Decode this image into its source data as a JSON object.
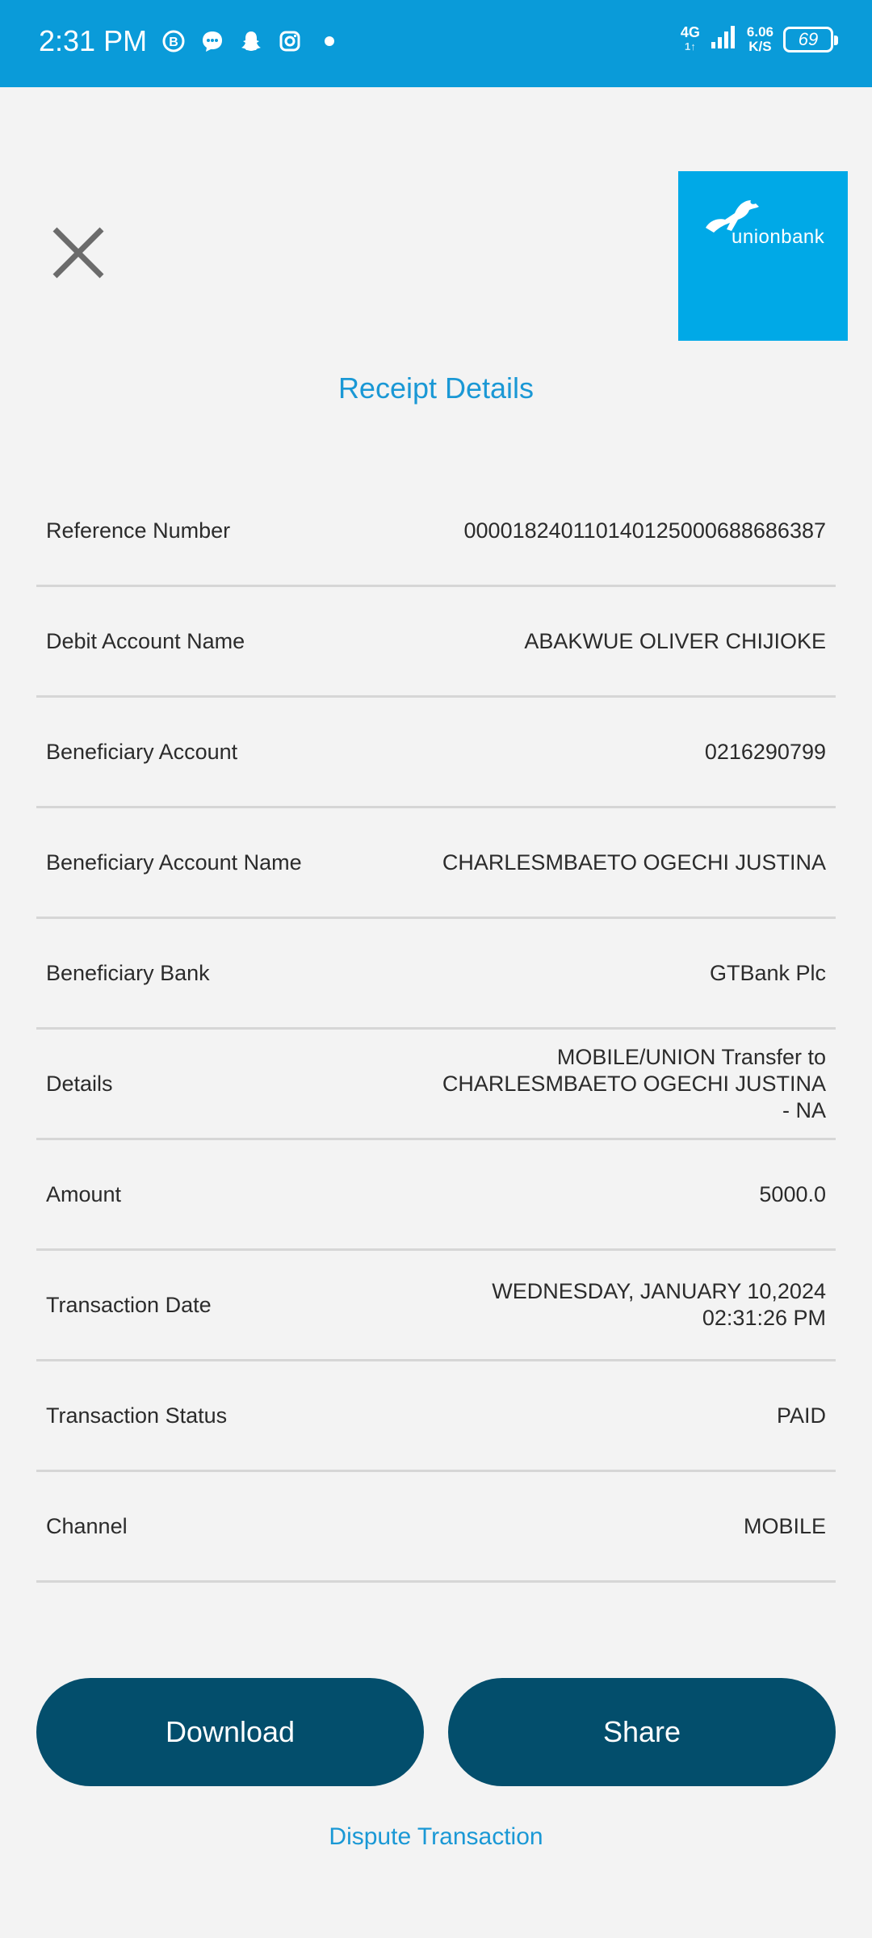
{
  "status_bar": {
    "time": "2:31 PM",
    "network": "4G",
    "network_sub": "1↑",
    "speed_value": "6.06",
    "speed_unit": "K/S",
    "battery": "69",
    "icons": [
      "b-chat-icon",
      "message-icon",
      "snapchat-icon",
      "instagram-icon",
      "dot-icon"
    ]
  },
  "header": {
    "logo_text": "unionbank",
    "title": "Receipt Details"
  },
  "rows": [
    {
      "label": "Reference Number",
      "value": "000018240110140125000688686387"
    },
    {
      "label": "Debit Account Name",
      "value": "ABAKWUE OLIVER CHIJIOKE"
    },
    {
      "label": "Beneficiary Account",
      "value": "0216290799"
    },
    {
      "label": "Beneficiary Account Name",
      "value": "CHARLESMBAETO OGECHI JUSTINA"
    },
    {
      "label": "Beneficiary Bank",
      "value": "GTBank Plc"
    },
    {
      "label": "Details",
      "value": "MOBILE/UNION Transfer to CHARLESMBAETO OGECHI JUSTINA - NA"
    },
    {
      "label": "Amount",
      "value": "5000.0"
    },
    {
      "label": "Transaction Date",
      "value": "WEDNESDAY, JANUARY 10,2024 02:31:26 PM"
    },
    {
      "label": "Transaction Status",
      "value": "PAID"
    },
    {
      "label": "Channel",
      "value": "MOBILE"
    }
  ],
  "actions": {
    "download": "Download",
    "share": "Share",
    "dispute": "Dispute Transaction"
  },
  "colors": {
    "status_bar": "#0a9bd9",
    "accent": "#1a98d5",
    "button": "#034e6c",
    "logo_bg": "#00a9e7"
  }
}
